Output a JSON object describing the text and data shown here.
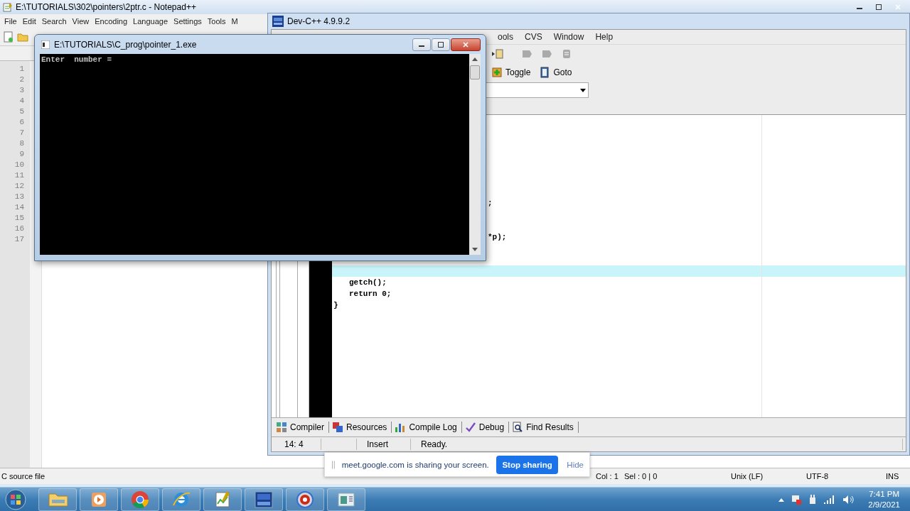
{
  "notepad": {
    "title": "E:\\TUTORIALS\\302\\pointers\\2ptr.c - Notepad++",
    "menu": [
      "File",
      "Edit",
      "Search",
      "View",
      "Encoding",
      "Language",
      "Settings",
      "Tools",
      "M"
    ],
    "line_numbers": [
      "1",
      "2",
      "3",
      "4",
      "5",
      "6",
      "7",
      "8",
      "9",
      "10",
      "11",
      "12",
      "13",
      "14",
      "15",
      "16",
      "17"
    ],
    "status_bar": {
      "file_type": "C source file",
      "column": "Col : 1",
      "selection": "Sel : 0 | 0",
      "line_ending": "Unix (LF)",
      "encoding": "UTF-8",
      "mode": "INS"
    }
  },
  "devcpp": {
    "title": "Dev-C++ 4.9.9.2",
    "menu": [
      "ools",
      "CVS",
      "Window",
      "Help"
    ],
    "buttons": [
      "Toggle",
      "Goto"
    ],
    "code_lines": [
      ";",
      "*p);",
      "getch();",
      "return 0;",
      "}"
    ],
    "bottom_tabs": [
      "Compiler",
      "Resources",
      "Compile Log",
      "Debug",
      "Find Results"
    ],
    "status_bar": {
      "position": "14: 4",
      "mode": "Insert",
      "message": "Ready."
    }
  },
  "console": {
    "title": "E:\\TUTORIALS\\C_prog\\pointer_1.exe",
    "output": "Enter  number ="
  },
  "share_bar": {
    "message": "meet.google.com is sharing your screen.",
    "stop_button": "Stop sharing",
    "hide_link": "Hide"
  },
  "taskbar": {
    "time": "7:41 PM",
    "date": "2/9/2021"
  }
}
